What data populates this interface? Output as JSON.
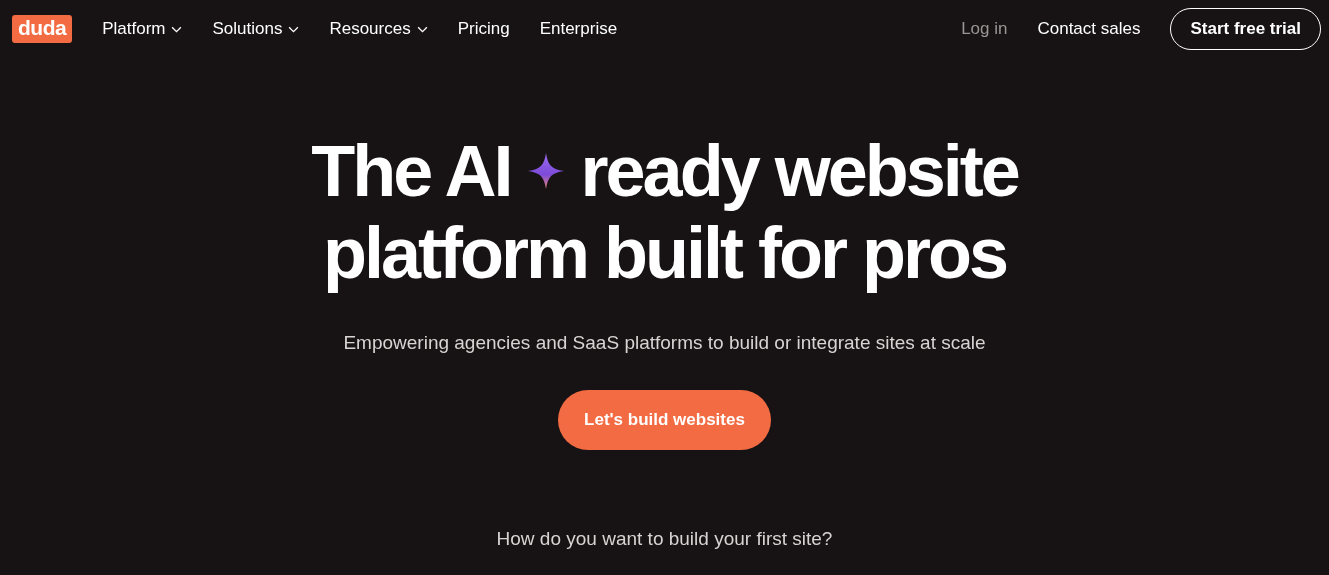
{
  "logo": "duda",
  "nav": [
    {
      "label": "Platform",
      "has_menu": true
    },
    {
      "label": "Solutions",
      "has_menu": true
    },
    {
      "label": "Resources",
      "has_menu": true
    },
    {
      "label": "Pricing",
      "has_menu": false
    },
    {
      "label": "Enterprise",
      "has_menu": false
    }
  ],
  "actions": {
    "login": "Log in",
    "contact": "Contact sales",
    "trial": "Start free trial"
  },
  "hero": {
    "title_start": "The AI",
    "title_end": "ready website",
    "title_line2": "platform built for pros",
    "subtitle": "Empowering agencies and SaaS platforms to build or integrate sites at scale",
    "cta": "Let's build websites",
    "question": "How do you want to build your first site?"
  }
}
